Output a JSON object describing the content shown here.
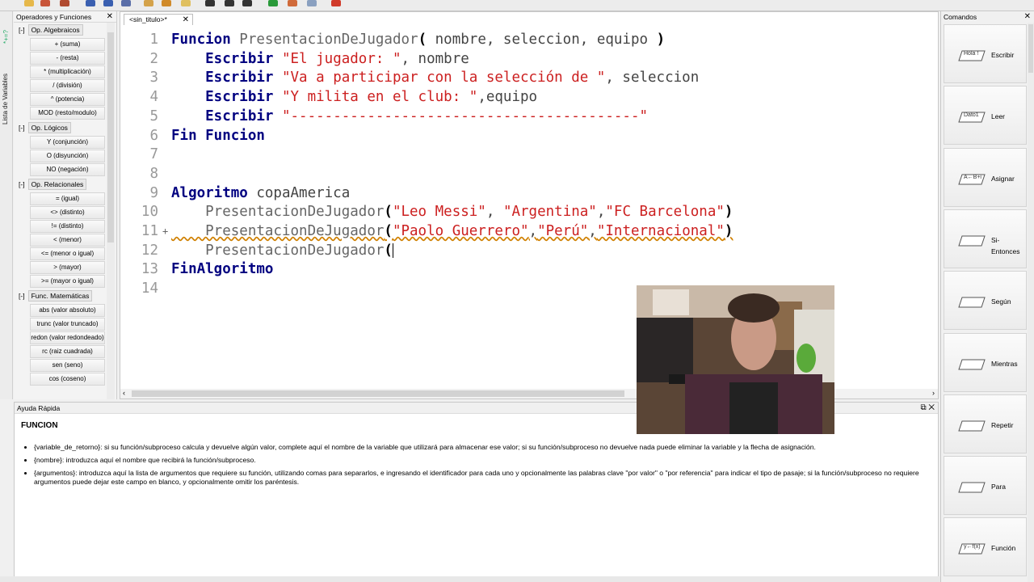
{
  "ops_panel": {
    "title": "Operadores y Funciones",
    "groups": [
      {
        "label": "Op. Algebraicos",
        "items": [
          "+ (suma)",
          "- (resta)",
          "* (multiplicación)",
          "/ (división)",
          "^ (potencia)",
          "MOD (resto/modulo)"
        ]
      },
      {
        "label": "Op. Lógicos",
        "items": [
          "Y (conjunción)",
          "O (disyunción)",
          "NO (negación)"
        ]
      },
      {
        "label": "Op. Relacionales",
        "items": [
          "= (igual)",
          "<> (distinto)",
          "!= (distinto)",
          "< (menor)",
          "<= (menor o igual)",
          "> (mayor)",
          ">= (mayor o igual)"
        ]
      },
      {
        "label": "Func. Matemáticas",
        "items": [
          "abs (valor absoluto)",
          "trunc (valor truncado)",
          "redon (valor redondeado)",
          "rc (raiz cuadrada)",
          "sen (seno)",
          "cos (coseno)"
        ]
      }
    ]
  },
  "side_strip": {
    "label": "Lista de Variables",
    "icon_text": "*+=?"
  },
  "editor": {
    "tab_label": "<sin_titulo>*",
    "lines": [
      {
        "n": "1",
        "marker": "",
        "parts": [
          {
            "c": "kw",
            "t": "Funcion"
          },
          {
            "c": "fn",
            "t": " PresentacionDeJugador"
          },
          {
            "c": "pn",
            "t": "("
          },
          {
            "c": "id",
            "t": " nombre, seleccion, equipo "
          },
          {
            "c": "pn",
            "t": ")"
          }
        ]
      },
      {
        "n": "2",
        "marker": "",
        "parts": [
          {
            "c": "kw",
            "t": "    Escribir"
          },
          {
            "c": "st",
            "t": " \"El jugador: \""
          },
          {
            "c": "id",
            "t": ", nombre"
          }
        ]
      },
      {
        "n": "3",
        "marker": "",
        "parts": [
          {
            "c": "kw",
            "t": "    Escribir"
          },
          {
            "c": "st",
            "t": " \"Va a participar con la selección de \""
          },
          {
            "c": "id",
            "t": ", seleccion"
          }
        ]
      },
      {
        "n": "4",
        "marker": "",
        "parts": [
          {
            "c": "kw",
            "t": "    Escribir"
          },
          {
            "c": "st",
            "t": " \"Y milita en el club: \""
          },
          {
            "c": "id",
            "t": ",equipo"
          }
        ]
      },
      {
        "n": "5",
        "marker": "",
        "parts": [
          {
            "c": "kw",
            "t": "    Escribir"
          },
          {
            "c": "st",
            "t": " \"-----------------------------------------\""
          }
        ]
      },
      {
        "n": "6",
        "marker": "",
        "parts": [
          {
            "c": "kw",
            "t": "Fin Funcion"
          }
        ]
      },
      {
        "n": "7",
        "marker": "",
        "parts": []
      },
      {
        "n": "8",
        "marker": "",
        "parts": []
      },
      {
        "n": "9",
        "marker": "",
        "parts": [
          {
            "c": "kw",
            "t": "Algoritmo"
          },
          {
            "c": "id",
            "t": " copaAmerica"
          }
        ]
      },
      {
        "n": "10",
        "marker": "",
        "parts": [
          {
            "c": "fn",
            "t": "    PresentacionDeJugador"
          },
          {
            "c": "pn",
            "t": "("
          },
          {
            "c": "st",
            "t": "\"Leo Messi\""
          },
          {
            "c": "id",
            "t": ", "
          },
          {
            "c": "st",
            "t": "\"Argentina\""
          },
          {
            "c": "id",
            "t": ","
          },
          {
            "c": "st",
            "t": "\"FC Barcelona\""
          },
          {
            "c": "pn",
            "t": ")"
          }
        ]
      },
      {
        "n": "11",
        "marker": "+",
        "parts": [
          {
            "c": "fn sq",
            "t": "    PresentacionDeJugador"
          },
          {
            "c": "pn sq",
            "t": "("
          },
          {
            "c": "st sq",
            "t": "\"Paolo Guerrero\""
          },
          {
            "c": "id sq",
            "t": ","
          },
          {
            "c": "st sq",
            "t": "\"Perú\""
          },
          {
            "c": "id sq",
            "t": ","
          },
          {
            "c": "st sq",
            "t": "\"Internacional\""
          },
          {
            "c": "pn sq",
            "t": ")"
          }
        ]
      },
      {
        "n": "12",
        "marker": "",
        "parts": [
          {
            "c": "fn",
            "t": "    PresentacionDeJugador"
          },
          {
            "c": "pn",
            "t": "("
          }
        ]
      },
      {
        "n": "13",
        "marker": "",
        "parts": [
          {
            "c": "kw",
            "t": "FinAlgoritmo"
          }
        ]
      },
      {
        "n": "14",
        "marker": "",
        "parts": []
      }
    ]
  },
  "help": {
    "header": "Ayuda Rápida",
    "title": "FUNCION",
    "items": [
      "{variable_de_retorno}: si su función/subproceso calcula y devuelve algún valor, complete aquí el nombre de la variable que utilizará para almacenar ese valor; si su función/subproceso no devuelve nada puede eliminar la variable y la flecha de asignación.",
      "{nombre}: introduzca aquí el nombre que recibirá la función/subproceso.",
      "{argumentos}: introduzca aquí la lista de argumentos que requiere su función, utilizando comas para separarlos, e ingresando el identificador para cada uno y opcionalmente las palabras clave \"por valor\" o \"por referencia\" para indicar el tipo de pasaje; si la función/subproceso no requiere argumentos puede dejar este campo en blanco, y opcionalmente omitir los paréntesis."
    ]
  },
  "commands": {
    "title": "Comandos",
    "items": [
      {
        "label": "Escribir",
        "icon": "write-icon",
        "glyph": "Hola !"
      },
      {
        "label": "Leer",
        "icon": "read-icon",
        "glyph": "Dato1"
      },
      {
        "label": "Asignar",
        "icon": "assign-icon",
        "glyph": "A←B+i"
      },
      {
        "label": "Si-Entonces",
        "icon": "if-icon",
        "glyph": ""
      },
      {
        "label": "Según",
        "icon": "switch-icon",
        "glyph": ""
      },
      {
        "label": "Mientras",
        "icon": "while-icon",
        "glyph": ""
      },
      {
        "label": "Repetir",
        "icon": "repeat-icon",
        "glyph": ""
      },
      {
        "label": "Para",
        "icon": "for-icon",
        "glyph": ""
      },
      {
        "label": "Función",
        "icon": "function-icon",
        "glyph": "y←f(x)"
      }
    ]
  },
  "colors": {
    "keyword": "#000080",
    "string": "#cc2020",
    "identifier": "#444444"
  }
}
